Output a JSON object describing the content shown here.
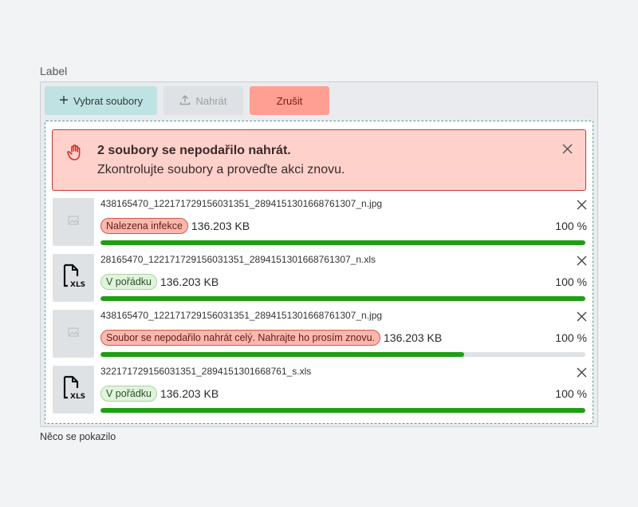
{
  "field": {
    "label": "Label",
    "helper": "Něco se pokazilo"
  },
  "toolbar": {
    "select_label": "Vybrat soubory",
    "upload_label": "Nahrát",
    "cancel_label": "Zrušit"
  },
  "alert": {
    "title": "2 soubory se nepodařilo nahrát.",
    "message": "Zkontrolujte soubory a proveďte akci znovu."
  },
  "files": [
    {
      "name": "438165470_122171729156031351_2894151301668761307_n.jpg",
      "kind": "image",
      "status": "Nalezena infekce",
      "status_type": "error",
      "size": "136.203 KB",
      "percent": "100 %",
      "progress": 1.0
    },
    {
      "name": "28165470_122171729156031351_2894151301668761307_n.xls",
      "kind": "xls",
      "status": "V pořádku",
      "status_type": "ok",
      "size": "136.203 KB",
      "percent": "100 %",
      "progress": 1.0
    },
    {
      "name": "438165470_122171729156031351_2894151301668761307_n.jpg",
      "kind": "image",
      "status": "Soubor se nepodařilo nahrát celý. Nahrajte ho prosím znovu.",
      "status_type": "error",
      "size": "136.203 KB",
      "percent": "100 %",
      "progress": 0.75
    },
    {
      "name": "322171729156031351_2894151301668761_s.xls",
      "kind": "xls",
      "status": "V pořádku",
      "status_type": "ok",
      "size": "136.203 KB",
      "percent": "100 %",
      "progress": 1.0
    }
  ],
  "colors": {
    "accent_select": "#bfe3e2",
    "danger": "#ff9f94",
    "alert_bg": "#ffd1cb",
    "progress": "#1f9e14"
  }
}
